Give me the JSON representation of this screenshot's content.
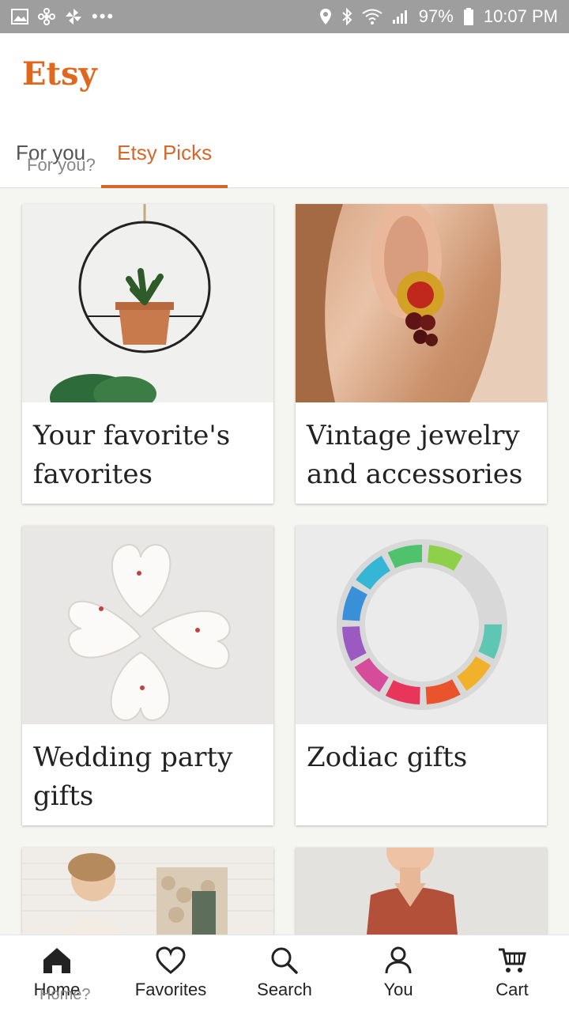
{
  "status_bar": {
    "battery": "97%",
    "time": "10:07 PM",
    "icons": [
      "image-icon",
      "fan-icon",
      "pinwheel-icon",
      "more-dots-icon",
      "location-icon",
      "bluetooth-icon",
      "wifi-icon",
      "signal-icon",
      "battery-icon"
    ]
  },
  "app": {
    "logo": "Etsy",
    "accent": "#d6662c"
  },
  "tabs": [
    {
      "label": "For you",
      "ghost": "For you?",
      "active": false
    },
    {
      "label": "Etsy Picks",
      "active": true
    }
  ],
  "cards": [
    {
      "title": "Your favorite's favorites",
      "image": "hanging plant in hoop"
    },
    {
      "title": "Vintage jewelry and accessories",
      "image": "earring"
    },
    {
      "title": "Wedding party gifts",
      "image": "heart dishes"
    },
    {
      "title": "Zodiac gifts",
      "image": "zodiac candles ring"
    },
    {
      "title": "",
      "image": "weaving wall hanging"
    },
    {
      "title": "",
      "image": "model in top"
    }
  ],
  "bottom_nav": {
    "items": [
      {
        "label": "Home",
        "icon": "home-icon",
        "ghost": "Home?"
      },
      {
        "label": "Favorites",
        "icon": "heart-icon"
      },
      {
        "label": "Search",
        "icon": "search-icon"
      },
      {
        "label": "You",
        "icon": "person-icon"
      },
      {
        "label": "Cart",
        "icon": "cart-icon"
      }
    ]
  }
}
